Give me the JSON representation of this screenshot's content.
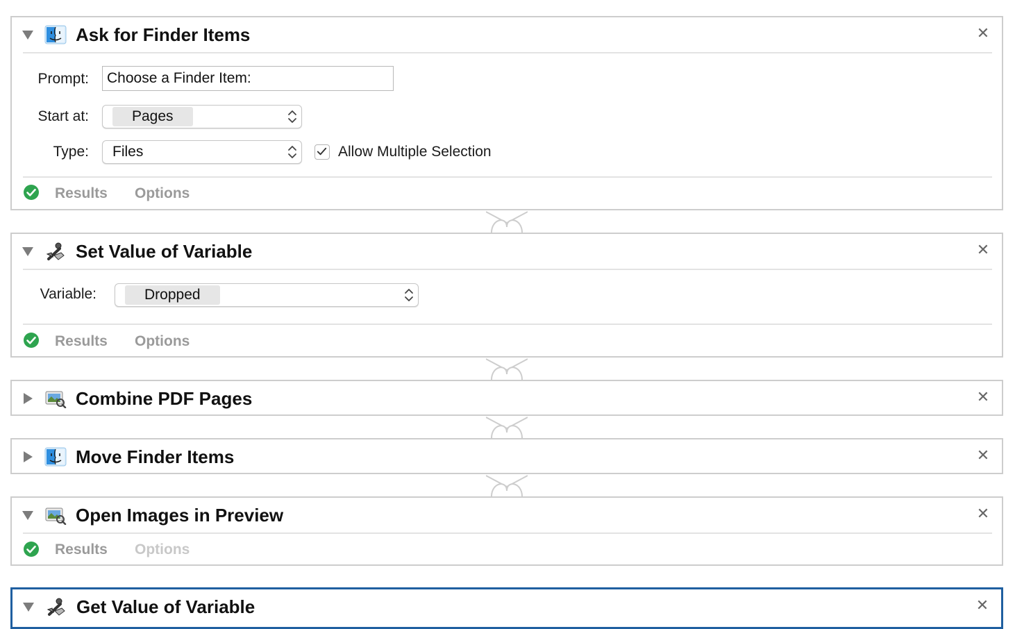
{
  "actions": [
    {
      "title": "Ask for Finder Items",
      "fields": {
        "prompt_label": "Prompt:",
        "prompt_value": "Choose a Finder Item:",
        "start_label": "Start at:",
        "start_value": "Pages",
        "type_label": "Type:",
        "type_value": "Files",
        "multi_label": "Allow Multiple Selection",
        "multi_checked": true
      },
      "results_label": "Results",
      "options_label": "Options",
      "status": "success"
    },
    {
      "title": "Set Value of Variable",
      "fields": {
        "variable_label": "Variable:",
        "variable_value": "Dropped"
      },
      "results_label": "Results",
      "options_label": "Options",
      "status": "success"
    },
    {
      "title": "Combine PDF Pages",
      "collapsed": true
    },
    {
      "title": "Move Finder Items",
      "collapsed": true
    },
    {
      "title": "Open Images in Preview",
      "results_label": "Results",
      "options_label": "Options",
      "options_enabled": false,
      "status": "success"
    },
    {
      "title": "Get Value of Variable",
      "selected": true
    }
  ],
  "icons": {
    "disclosure_expanded": "triangle-down-icon",
    "disclosure_collapsed": "triangle-right-icon",
    "finder": "finder-icon",
    "variable": "variable-icon",
    "preview": "preview-icon",
    "close": "close-icon",
    "success": "green-checkmark-icon"
  },
  "colors": {
    "success_green": "#2ea44f",
    "selection_blue": "#1f5fa0",
    "border_gray": "#cdcdcd"
  }
}
